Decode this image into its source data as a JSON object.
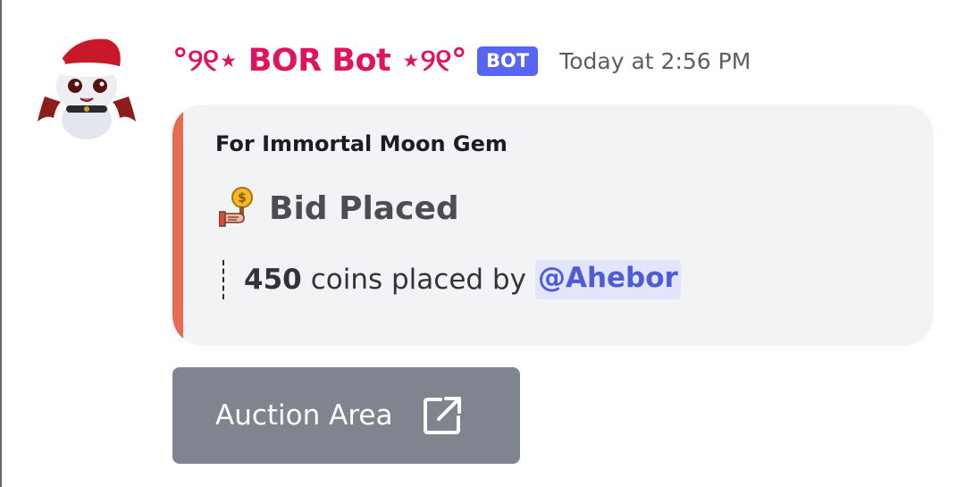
{
  "message": {
    "author": {
      "display_name": "°୨୧⋆ BOR Bot ⋆୨୧°",
      "badge": "BOT",
      "avatar_icon": "christmas-bat-avatar"
    },
    "timestamp": "Today at 2:56 PM",
    "embed": {
      "accent_color": "#e66b52",
      "author": "For Immortal Moon Gem",
      "title_icon": "hand-holding-coin-icon",
      "title": "Bid Placed",
      "description": {
        "amount": "450",
        "text": "coins placed by",
        "mention": "@Ahebor"
      }
    },
    "button": {
      "label": "Auction Area",
      "icon": "external-link-icon"
    }
  },
  "colors": {
    "username": "#e0135e",
    "bot_badge": "#5865f2",
    "embed_background": "#f2f3f5",
    "mention_text": "#4e5dd6",
    "mention_background": "#e3e6fb",
    "button_background": "#80848e"
  }
}
